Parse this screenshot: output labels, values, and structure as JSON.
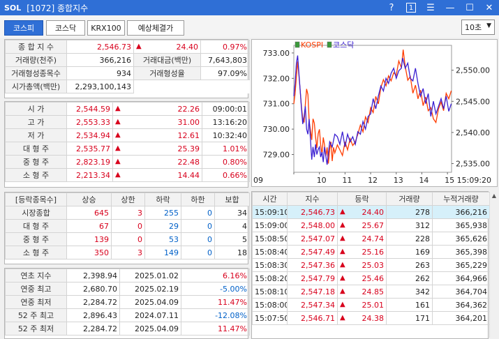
{
  "window": {
    "logo": "SOL",
    "title": "[1072] 종합지수",
    "help": "?",
    "page": "1",
    "menu": "☰",
    "minimize": "—",
    "maximize": "☐",
    "close": "✕"
  },
  "tabs": [
    {
      "label": "코스피",
      "active": true
    },
    {
      "label": "코스닥",
      "active": false
    },
    {
      "label": "KRX100",
      "active": false
    },
    {
      "label": "예상체결가",
      "active": false
    }
  ],
  "period": {
    "value": "10초"
  },
  "summary": {
    "index_label": "종 합 지 수",
    "index_value": "2,546.73",
    "index_change": "24.40",
    "index_rate": "0.97%",
    "volume_label": "거래량(천주)",
    "volume_value": "366,216",
    "amount_label": "거래대금(백만)",
    "amount_value": "7,643,803",
    "traded_count_label": "거래형성종목수",
    "traded_count_value": "934",
    "traded_rate_label": "거래형성율",
    "traded_rate_value": "97.09%",
    "marketcap_label": "시가총액(백만)",
    "marketcap_value": "2,293,100,143"
  },
  "prices": [
    {
      "label": "시      가",
      "value": "2,544.59",
      "change": "22.26",
      "extra": "09:00:01"
    },
    {
      "label": "고      가",
      "value": "2,553.33",
      "change": "31.00",
      "extra": "13:16:20"
    },
    {
      "label": "저      가",
      "value": "2,534.94",
      "change": "12.61",
      "extra": "10:32:40"
    },
    {
      "label": "대 형 주",
      "value": "2,535.77",
      "change": "25.39",
      "extra": "1.01%"
    },
    {
      "label": "중 형 주",
      "value": "2,823.19",
      "change": "22.48",
      "extra": "0.80%"
    },
    {
      "label": "소 형 주",
      "value": "2,213.34",
      "change": "14.44",
      "extra": "0.66%"
    }
  ],
  "breadth": {
    "headers": [
      "[등락종목수]",
      "상승",
      "상한",
      "하락",
      "하한",
      "보합"
    ],
    "rows": [
      {
        "label": "시장종합",
        "up": "645",
        "upper": "3",
        "down": "255",
        "lower": "0",
        "flat": "34"
      },
      {
        "label": "대 형 주",
        "up": "67",
        "upper": "0",
        "down": "29",
        "lower": "0",
        "flat": "4"
      },
      {
        "label": "중 형 주",
        "up": "139",
        "upper": "0",
        "down": "53",
        "lower": "0",
        "flat": "5"
      },
      {
        "label": "소 형 주",
        "up": "350",
        "upper": "3",
        "down": "149",
        "lower": "0",
        "flat": "18"
      }
    ]
  },
  "yearly": [
    {
      "label": "연초  지수",
      "value": "2,398.94",
      "date": "2025.01.02",
      "rate": "6.16%",
      "color": "red"
    },
    {
      "label": "연중  최고",
      "value": "2,680.70",
      "date": "2025.02.19",
      "rate": "-5.00%",
      "color": "blue"
    },
    {
      "label": "연중  최저",
      "value": "2,284.72",
      "date": "2025.04.09",
      "rate": "11.47%",
      "color": "red"
    },
    {
      "label": "52 주 최고",
      "value": "2,896.43",
      "date": "2024.07.11",
      "rate": "-12.08%",
      "color": "blue"
    },
    {
      "label": "52 주 최저",
      "value": "2,284.72",
      "date": "2025.04.09",
      "rate": "11.47%",
      "color": "red"
    }
  ],
  "ticks": {
    "headers": [
      "시간",
      "지수",
      "등락",
      "거래량",
      "누적거래량"
    ],
    "rows": [
      {
        "time": "15:09:10",
        "index": "2,546.73",
        "change": "24.40",
        "volume": "278",
        "cum": "366,216"
      },
      {
        "time": "15:09:00",
        "index": "2,548.00",
        "change": "25.67",
        "volume": "312",
        "cum": "365,938"
      },
      {
        "time": "15:08:50",
        "index": "2,547.07",
        "change": "24.74",
        "volume": "228",
        "cum": "365,626"
      },
      {
        "time": "15:08:40",
        "index": "2,547.49",
        "change": "25.16",
        "volume": "169",
        "cum": "365,398"
      },
      {
        "time": "15:08:30",
        "index": "2,547.36",
        "change": "25.03",
        "volume": "263",
        "cum": "365,229"
      },
      {
        "time": "15:08:20",
        "index": "2,547.79",
        "change": "25.46",
        "volume": "262",
        "cum": "364,966"
      },
      {
        "time": "15:08:10",
        "index": "2,547.18",
        "change": "24.85",
        "volume": "342",
        "cum": "364,704"
      },
      {
        "time": "15:08:00",
        "index": "2,547.34",
        "change": "25.01",
        "volume": "161",
        "cum": "364,362"
      },
      {
        "time": "15:07:50",
        "index": "2,546.71",
        "change": "24.38",
        "volume": "171",
        "cum": "364,201"
      }
    ]
  },
  "chart_data": {
    "type": "line",
    "legend": [
      "KOSPI",
      "코스닥"
    ],
    "y_left_ticks": [
      "733.00",
      "732.00",
      "731.00",
      "730.00",
      "729.00"
    ],
    "y_right_ticks": [
      "2,550.00",
      "2,545.00",
      "2,540.00",
      "2,535.00"
    ],
    "x_ticks": [
      "09",
      "10",
      "11",
      "12",
      "13",
      "14",
      "15 15:09:20"
    ],
    "x_range": [
      9.0,
      15.16
    ],
    "y_left_range": [
      728.3,
      733.3
    ],
    "y_right_range": [
      2533.6,
      2554.0
    ],
    "series": [
      {
        "name": "KOSPI",
        "axis": "right",
        "color": "#ff3c00",
        "x": [
          9.0,
          9.05,
          9.1,
          9.15,
          9.2,
          9.25,
          9.3,
          9.35,
          9.4,
          9.45,
          9.5,
          9.55,
          9.6,
          9.65,
          9.7,
          9.75,
          9.8,
          9.85,
          9.9,
          9.95,
          10.0,
          10.05,
          10.1,
          10.15,
          10.2,
          10.25,
          10.3,
          10.35,
          10.4,
          10.45,
          10.5,
          10.55,
          10.6,
          10.7,
          10.8,
          10.9,
          11.0,
          11.1,
          11.2,
          11.3,
          11.4,
          11.5,
          11.6,
          11.7,
          11.8,
          11.9,
          12.0,
          12.1,
          12.2,
          12.3,
          12.4,
          12.5,
          12.6,
          12.7,
          12.8,
          12.9,
          13.0,
          13.1,
          13.2,
          13.27,
          13.35,
          13.45,
          13.55,
          13.65,
          13.75,
          13.85,
          13.95,
          14.05,
          14.15,
          14.25,
          14.35,
          14.45,
          14.55,
          14.65,
          14.75,
          14.85,
          14.95,
          15.05,
          15.15
        ],
        "values": [
          2544.6,
          2546.2,
          2549.0,
          2551.4,
          2549.2,
          2546.6,
          2544.1,
          2542.2,
          2541.6,
          2544.5,
          2547.0,
          2546.1,
          2541.8,
          2540.4,
          2538.8,
          2542.2,
          2541.5,
          2539.2,
          2537.5,
          2539.8,
          2540.5,
          2538.0,
          2536.4,
          2539.2,
          2538.0,
          2536.2,
          2537.6,
          2535.0,
          2537.3,
          2538.5,
          2535.4,
          2537.6,
          2536.7,
          2538.0,
          2537.2,
          2536.3,
          2538.5,
          2537.2,
          2539.0,
          2537.9,
          2538.5,
          2539.7,
          2541.2,
          2540.1,
          2542.5,
          2541.6,
          2544.0,
          2543.2,
          2545.8,
          2544.6,
          2547.2,
          2548.5,
          2547.5,
          2549.1,
          2548.3,
          2549.6,
          2549.2,
          2551.5,
          2550.4,
          2553.3,
          2550.6,
          2548.4,
          2549.0,
          2546.3,
          2547.6,
          2545.4,
          2546.8,
          2544.3,
          2545.7,
          2543.5,
          2544.0,
          2542.2,
          2541.6,
          2543.8,
          2544.9,
          2543.5,
          2546.3,
          2545.4,
          2546.7
        ]
      },
      {
        "name": "코스닥",
        "axis": "left",
        "color": "#3a1fd1",
        "x": [
          9.0,
          9.05,
          9.1,
          9.15,
          9.2,
          9.25,
          9.3,
          9.35,
          9.4,
          9.45,
          9.5,
          9.55,
          9.6,
          9.65,
          9.7,
          9.75,
          9.8,
          9.85,
          9.9,
          9.95,
          10.0,
          10.05,
          10.1,
          10.15,
          10.2,
          10.3,
          10.4,
          10.5,
          10.6,
          10.7,
          10.8,
          10.9,
          11.0,
          11.1,
          11.2,
          11.3,
          11.4,
          11.5,
          11.6,
          11.7,
          11.8,
          11.9,
          12.0,
          12.1,
          12.2,
          12.3,
          12.4,
          12.5,
          12.6,
          12.7,
          12.8,
          12.9,
          13.0,
          13.1,
          13.2,
          13.25,
          13.35,
          13.45,
          13.55,
          13.65,
          13.75,
          13.85,
          13.95,
          14.05,
          14.15,
          14.25,
          14.35,
          14.45,
          14.55,
          14.65,
          14.75,
          14.85,
          14.95,
          15.05,
          15.15
        ],
        "values": [
          731.3,
          731.8,
          732.6,
          732.9,
          732.2,
          731.5,
          730.8,
          730.2,
          730.5,
          730.9,
          730.0,
          729.8,
          730.4,
          729.6,
          728.8,
          729.3,
          728.9,
          729.4,
          729.0,
          729.2,
          729.3,
          728.9,
          729.1,
          728.7,
          729.3,
          728.6,
          729.5,
          729.3,
          729.8,
          729.7,
          729.4,
          729.9,
          729.3,
          729.8,
          729.5,
          729.7,
          729.4,
          729.9,
          729.8,
          730.3,
          730.0,
          730.5,
          730.6,
          731.2,
          730.8,
          731.3,
          731.7,
          731.5,
          732.0,
          731.8,
          732.2,
          732.4,
          732.0,
          732.3,
          732.4,
          732.8,
          732.4,
          732.6,
          732.0,
          731.9,
          732.4,
          731.8,
          731.3,
          731.6,
          731.0,
          731.4,
          730.5,
          731.1,
          730.6,
          730.9,
          731.2,
          730.8,
          731.3,
          730.7,
          731.0
        ]
      }
    ]
  }
}
